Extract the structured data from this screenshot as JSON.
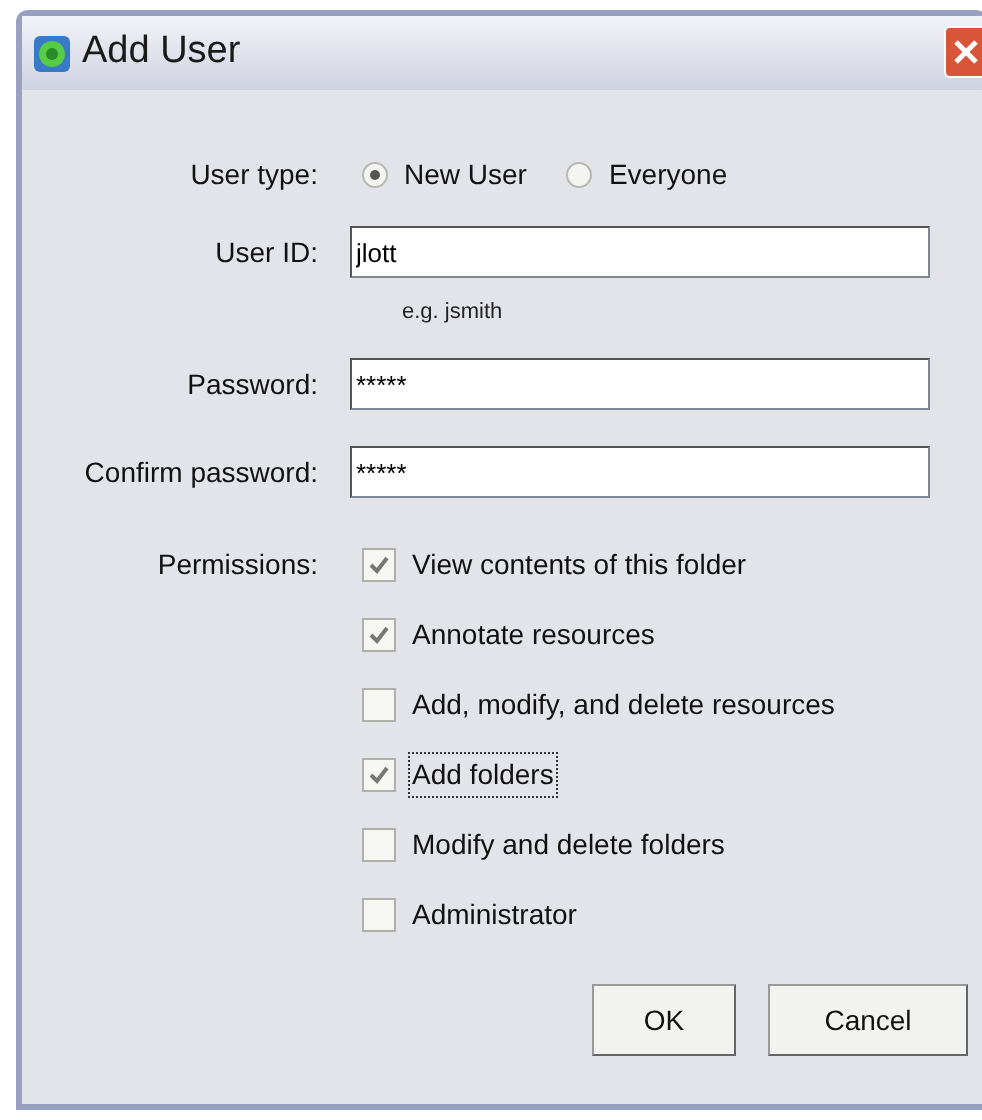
{
  "window": {
    "title": "Add User"
  },
  "user_type": {
    "label": "User type:",
    "options": [
      {
        "label": "New User",
        "selected": true
      },
      {
        "label": "Everyone",
        "selected": false
      }
    ]
  },
  "user_id": {
    "label": "User ID:",
    "value": "jlott",
    "hint": "e.g. jsmith"
  },
  "password": {
    "label": "Password:",
    "value": "*****"
  },
  "confirm_password": {
    "label": "Confirm password:",
    "value": "*****"
  },
  "permissions": {
    "label": "Permissions:",
    "items": [
      {
        "label": "View contents of this folder",
        "checked": true,
        "focused": false
      },
      {
        "label": "Annotate resources",
        "checked": true,
        "focused": false
      },
      {
        "label": "Add, modify, and delete resources",
        "checked": false,
        "focused": false
      },
      {
        "label": "Add folders",
        "checked": true,
        "focused": true
      },
      {
        "label": "Modify and delete folders",
        "checked": false,
        "focused": false
      },
      {
        "label": "Administrator",
        "checked": false,
        "focused": false
      }
    ]
  },
  "buttons": [
    "OK",
    "Cancel"
  ]
}
